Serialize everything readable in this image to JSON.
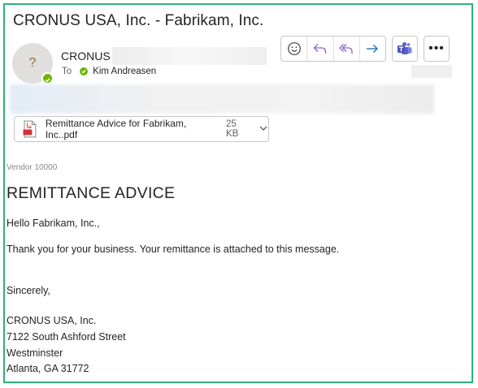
{
  "header": {
    "subject": "CRONUS USA, Inc. - Fabrikam, Inc.",
    "sender_name": "CRONUS",
    "avatar_initial": "?",
    "to_label": "To",
    "recipient": "Kim Andreasen"
  },
  "toolbar": {
    "icons": [
      "emoji-icon",
      "reply-icon",
      "reply-all-icon",
      "forward-icon",
      "teams-icon",
      "more-icon"
    ],
    "more_label": "•••"
  },
  "attachment": {
    "name": "Remittance Advice for Fabrikam, Inc..pdf",
    "size": "25 KB",
    "icon": "pdf-icon"
  },
  "body": {
    "vendor": "Vendor 10000",
    "title": "REMITTANCE ADVICE",
    "greeting": "Hello Fabrikam, Inc.,",
    "message": "Thank you for your business. Your remittance is attached to this message.",
    "closing": "Sincerely,",
    "company": "CRONUS USA, Inc.",
    "street": "7122 South Ashford Street",
    "city": "Westminster",
    "city_state_zip": "Atlanta, GA 31772"
  },
  "colors": {
    "frame_border": "#2bb37a",
    "reply_accent": "#8a63c9",
    "forward_accent": "#0f6cbd",
    "presence": "#6bb700",
    "pdf_red": "#d13438",
    "teams": "#5b5fc7"
  }
}
